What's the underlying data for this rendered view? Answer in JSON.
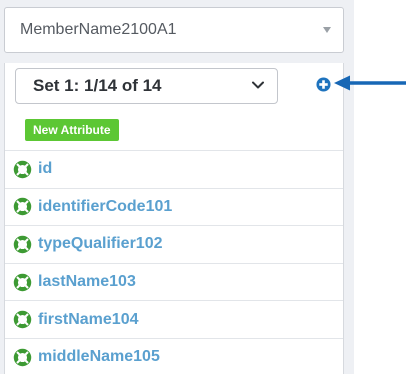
{
  "member_select": {
    "value": "MemberName2100A1"
  },
  "set_select": {
    "value": "Set 1: 1/14 of 14"
  },
  "new_attribute_button": {
    "label": "New Attribute"
  },
  "attributes": [
    {
      "label": "id"
    },
    {
      "label": "identifierCode101"
    },
    {
      "label": "typeQualifier102"
    },
    {
      "label": "lastName103"
    },
    {
      "label": "firstName104"
    },
    {
      "label": "middleName105"
    }
  ],
  "icons": {
    "attribute": "lifebuoy-icon",
    "add_set": "plus-circle-icon",
    "annotation": "arrow-left-icon"
  },
  "colors": {
    "link_blue": "#5aa0cf",
    "add_icon_blue": "#1e73be",
    "arrow_blue": "#1767b5",
    "button_green": "#5cc734",
    "ring_green": "#3d9a33"
  }
}
